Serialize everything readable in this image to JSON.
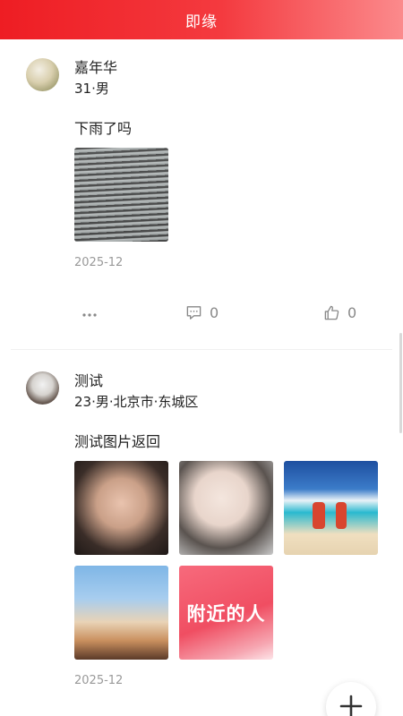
{
  "header": {
    "title": "即缘"
  },
  "posts": [
    {
      "name": "嘉年华",
      "meta": "31·男",
      "content": "下雨了吗",
      "date": "2025-12",
      "comment_count": "0",
      "like_count": "0"
    },
    {
      "name": "测试",
      "meta": "23·男·北京市·东城区",
      "content": "测试图片返回",
      "date": "2025-12",
      "image_text": "附近的人"
    }
  ],
  "icons": {
    "more": "more-dots-icon",
    "comment": "comment-icon",
    "like": "thumbs-up-icon",
    "fab": "plus-icon"
  },
  "colors": {
    "brand": "#ee1d23",
    "muted": "#999999"
  }
}
